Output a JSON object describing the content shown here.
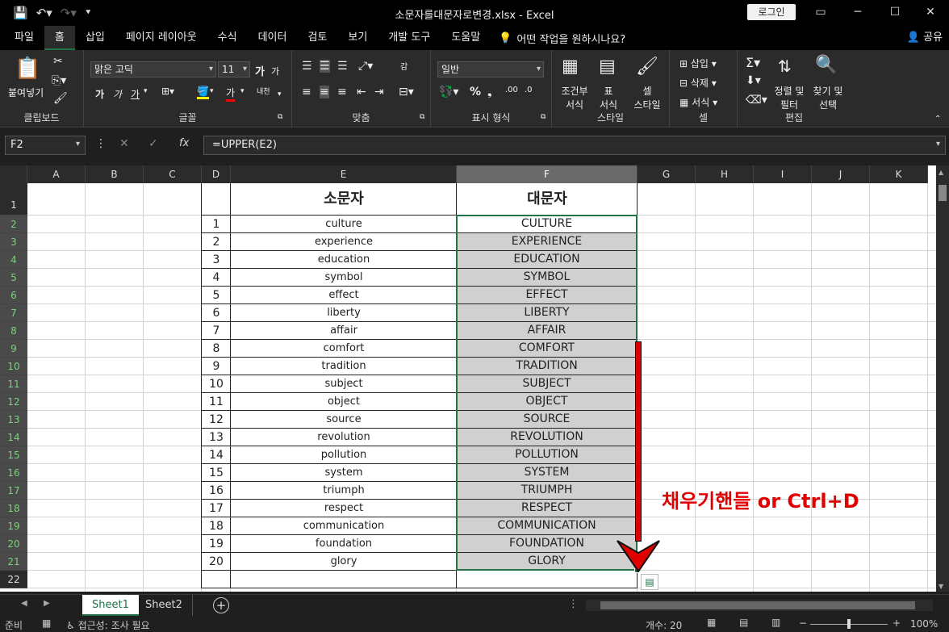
{
  "window": {
    "title": "소문자를대문자로변경.xlsx  -  Excel",
    "login_label": "로그인",
    "share_label": "공유",
    "minimize": "─",
    "restore": "☐",
    "close": "✕"
  },
  "menu": {
    "tabs": [
      "파일",
      "홈",
      "삽입",
      "페이지 레이아웃",
      "수식",
      "데이터",
      "검토",
      "보기",
      "개발 도구",
      "도움말"
    ],
    "active_index": 1,
    "tell_me": "어떤 작업을 원하시나요?"
  },
  "ribbon": {
    "clipboard": {
      "label": "클립보드",
      "paste": "붙여넣기"
    },
    "font": {
      "label": "글꼴",
      "name": "맑은 고딕",
      "size": "11",
      "grow": "가",
      "shrink": "가",
      "bold": "가",
      "italic": "가",
      "underline": "가",
      "color_letter": "가",
      "phonetic": "내천"
    },
    "align": {
      "label": "맞춤",
      "wrap": "감"
    },
    "number": {
      "label": "표시 형식",
      "format": "일반",
      "percent": "%"
    },
    "styles": {
      "label": "스타일",
      "cond_line1": "조건부",
      "cond_line2": "서식",
      "table_line1": "표",
      "table_line2": "서식",
      "cell_line1": "셀",
      "cell_line2": "스타일"
    },
    "cells": {
      "label": "셀",
      "insert": "삽입",
      "delete": "삭제",
      "format": "서식"
    },
    "editing": {
      "label": "편집",
      "sort_line1": "정렬 및",
      "sort_line2": "필터",
      "find_line1": "찾기 및",
      "find_line2": "선택"
    },
    "accent_color": "#217346"
  },
  "formula_bar": {
    "name_box": "F2",
    "fx": "fx",
    "formula": "=UPPER(E2)"
  },
  "columns": [
    "A",
    "B",
    "C",
    "D",
    "E",
    "F",
    "G",
    "H",
    "I",
    "J",
    "K"
  ],
  "selected_column": "F",
  "rows": [
    "1",
    "2",
    "3",
    "4",
    "5",
    "6",
    "7",
    "8",
    "9",
    "10",
    "11",
    "12",
    "13",
    "14",
    "15",
    "16",
    "17",
    "18",
    "19",
    "20",
    "21",
    "22"
  ],
  "table": {
    "header_lower": "소문자",
    "header_upper": "대문자",
    "numbers": [
      "1",
      "2",
      "3",
      "4",
      "5",
      "6",
      "7",
      "8",
      "9",
      "10",
      "11",
      "12",
      "13",
      "14",
      "15",
      "16",
      "17",
      "18",
      "19",
      "20"
    ],
    "lower": [
      "culture",
      "experience",
      "education",
      "symbol",
      "effect",
      "liberty",
      "affair",
      "comfort",
      "tradition",
      "subject",
      "object",
      "source",
      "revolution",
      "pollution",
      "system",
      "triumph",
      "respect",
      "communication",
      "foundation",
      "glory"
    ],
    "upper": [
      "CULTURE",
      "EXPERIENCE",
      "EDUCATION",
      "SYMBOL",
      "EFFECT",
      "LIBERTY",
      "AFFAIR",
      "COMFORT",
      "TRADITION",
      "SUBJECT",
      "OBJECT",
      "SOURCE",
      "REVOLUTION",
      "POLLUTION",
      "SYSTEM",
      "TRIUMPH",
      "RESPECT",
      "COMMUNICATION",
      "FOUNDATION",
      "GLORY"
    ]
  },
  "annotation": {
    "text": "채우기핸들 or Ctrl+D",
    "color": "#e00000"
  },
  "sheets": [
    "Sheet1",
    "Sheet2"
  ],
  "active_sheet": 0,
  "status": {
    "ready": "준비",
    "accessibility": "접근성: 조사 필요",
    "count": "개수: 20",
    "zoom": "100%"
  }
}
